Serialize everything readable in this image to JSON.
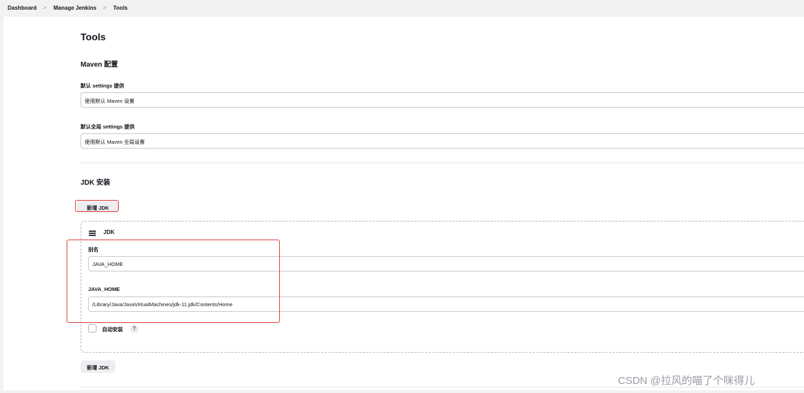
{
  "breadcrumb": {
    "items": [
      "Dashboard",
      "Manage Jenkins",
      "Tools"
    ],
    "separator": ">"
  },
  "page": {
    "title": "Tools"
  },
  "maven": {
    "section_title": "Maven 配置",
    "settings_label": "默认 settings 提供",
    "settings_value": "使用默认 Maven 设置",
    "global_settings_label": "默认全局 settings 提供",
    "global_settings_value": "使用默认 Maven 全局设置"
  },
  "jdk": {
    "section_title": "JDK 安装",
    "add_button_label": "新增 JDK",
    "card_title": "JDK",
    "alias_label": "别名",
    "alias_value": "JAVA_HOME",
    "home_label": "JAVA_HOME",
    "home_value": "/Library/Java/JavaVirtualMachines/jdk-11.jdk/Contents/Home",
    "auto_install_label": "自动安装",
    "auto_install_checked": false,
    "help_icon_glyph": "?",
    "bottom_add_button_label": "新增 JDK"
  },
  "watermark": "CSDN @拉风的喵了个咪得儿",
  "colors": {
    "highlight": "#e0413a",
    "page_background": "#ffffff",
    "chrome_background": "#f2f2f2"
  },
  "icons": [
    "hamburger-icon",
    "help-icon",
    "chevron-right-icon"
  ]
}
